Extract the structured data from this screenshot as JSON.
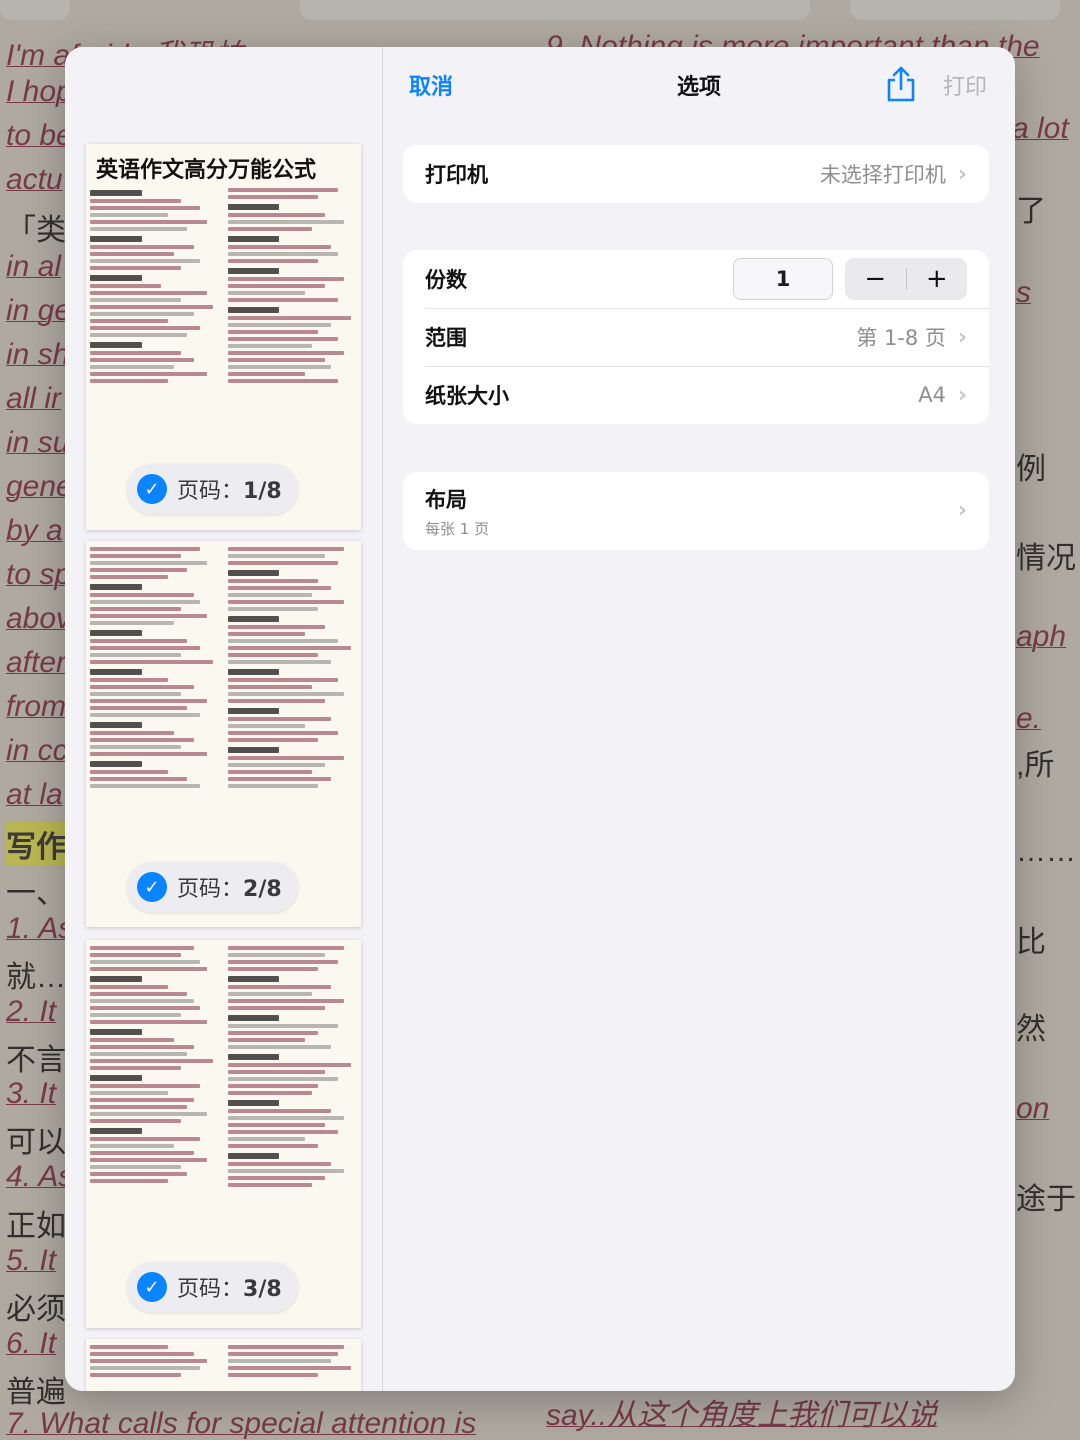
{
  "background_doc": {
    "left_lines": [
      "I'm afraid...我恐怕",
      "I hop",
      "to be",
      "actu",
      "「类",
      "in al",
      "in ge",
      "in sh",
      "all ir",
      "in su",
      "gene",
      "by a",
      "to sp",
      "abov",
      "after",
      "from",
      "in cc",
      "at la",
      "写作",
      "一、",
      "1. As",
      "就…",
      "2. It",
      "不言",
      "3. It",
      "可以",
      "4. As",
      "正如",
      "5. It",
      "必须",
      "6. It",
      "普遍",
      "7. What calls for special attention is"
    ],
    "right_lines": [
      "9. Nothing is more important than the",
      "a lot",
      "了",
      "s",
      "例",
      "情况",
      "aph",
      "e.",
      ",所",
      "……",
      "比",
      "然",
      "on",
      "途于",
      "",
      "say..从这个角度上我们可以说"
    ]
  },
  "nav": {
    "cancel": "取消",
    "title": "选项",
    "share_icon": "share-icon",
    "print": "打印"
  },
  "preview": {
    "doc_title": "英语作文高分万能公式",
    "pages": [
      {
        "label": "页码：",
        "num": "1/8",
        "selected": true
      },
      {
        "label": "页码：",
        "num": "2/8",
        "selected": true
      },
      {
        "label": "页码：",
        "num": "3/8",
        "selected": true
      }
    ]
  },
  "printer": {
    "label": "打印机",
    "value": "未选择打印机"
  },
  "options": {
    "copies_label": "份数",
    "copies_value": "1",
    "minus": "−",
    "plus": "+",
    "range_label": "范围",
    "range_value": "第 1-8 页",
    "paper_label": "纸张大小",
    "paper_value": "A4"
  },
  "layout": {
    "label": "布局",
    "sub": "每张 1 页"
  },
  "colors": {
    "accent": "#0a84ff",
    "disabled": "#b5b5ba",
    "panel_bg": "#f2f2f7"
  }
}
